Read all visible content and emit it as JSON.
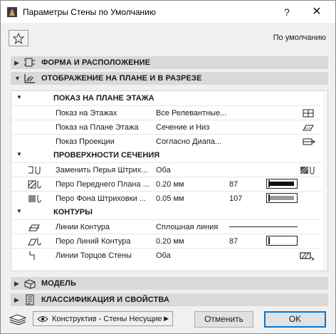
{
  "window": {
    "title": "Параметры Стены по Умолчанию",
    "help": "?",
    "close": "✕"
  },
  "top": {
    "default_label": "По умолчанию"
  },
  "sections": {
    "shape": "ФОРМА И РАСПОЛОЖЕНИЕ",
    "display": "ОТОБРАЖЕНИЕ НА ПЛАНЕ И В РАЗРЕЗЕ",
    "model": "МОДЕЛЬ",
    "classification": "КЛАССИФИКАЦИЯ И СВОЙСТВА"
  },
  "groups": {
    "floor_plan": "ПОКАЗ НА ПЛАНЕ ЭТАЖА",
    "cut_surfaces": "ПРОВЕРХНОСТИ СЕЧЕНИЯ",
    "outlines": "КОНТУРЫ"
  },
  "rows": {
    "show_on_stories": {
      "name": "Показ на Этажах",
      "value": "Все Релевантные..."
    },
    "show_on_floor_plan": {
      "name": "Показ на Плане Этажа",
      "value": "Сечение и Низ"
    },
    "show_projection": {
      "name": "Показ Проекции",
      "value": "Согласно Диапа..."
    },
    "override_pens": {
      "name": "Заменить Перья Штрих...",
      "value": "Оба"
    },
    "fg_pen": {
      "name": "Перо Переднего Плана ...",
      "value": "0.20 мм",
      "num": "87"
    },
    "bg_pen": {
      "name": "Перо Фона Штриховки ...",
      "value": "0.05 мм",
      "num": "107"
    },
    "outline_lines": {
      "name": "Линии Контура",
      "value": "Сплошная линия"
    },
    "outline_pen": {
      "name": "Перо Линий Контура",
      "value": "0.20 мм",
      "num": "87"
    },
    "end_lines": {
      "name": "Линии Торцов Стены",
      "value": "Оба"
    }
  },
  "bottom": {
    "layer_combo": "Конструктив - Стены Несущие",
    "cancel": "Отменить",
    "ok": "OK"
  },
  "colors": {
    "fg_pen_fill": "#111111",
    "bg_pen_fill": "#9a9a9a",
    "ok_border": "#0078d7"
  }
}
